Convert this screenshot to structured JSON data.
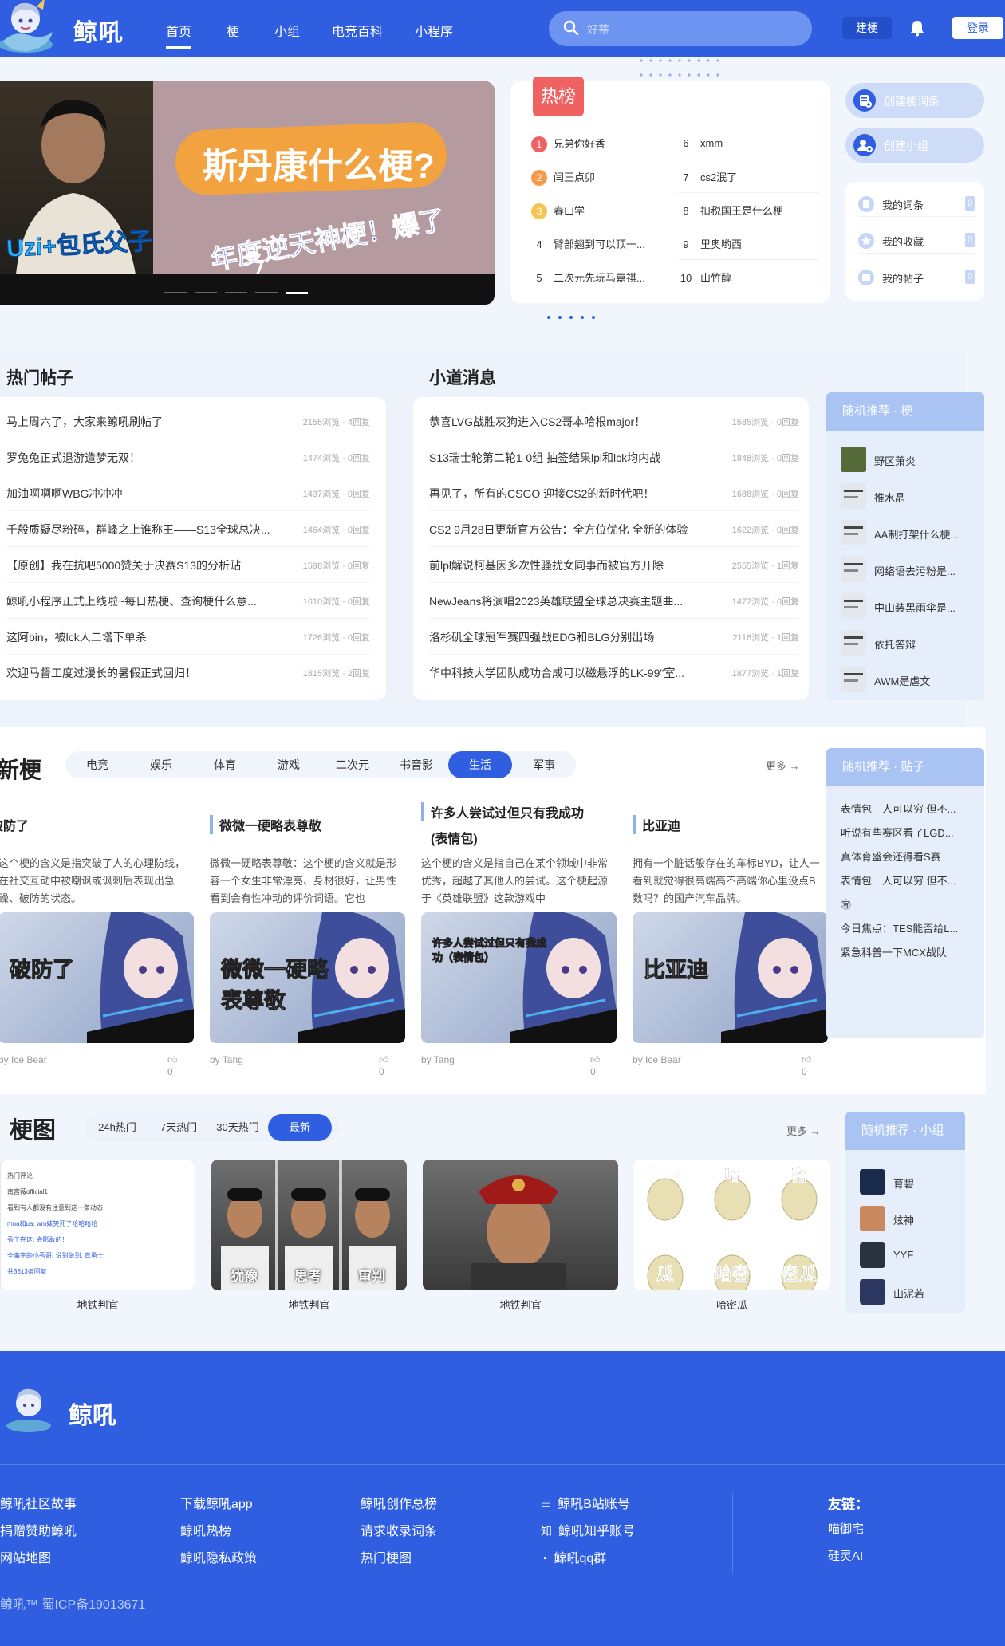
{
  "header": {
    "brand": "鲸吼",
    "nav": [
      "首页",
      "梗",
      "小组",
      "电竞百科",
      "小程序"
    ],
    "search_placeholder": "好蒂",
    "build_btn": "建梗",
    "login_btn": "登录"
  },
  "banner": {
    "left_caption": "Uzi+包氏父子",
    "question": "斯丹康什么梗?",
    "sub": "年度逆天神梗！爆了",
    "dots": 5,
    "active_dot": 4
  },
  "hot_rank": {
    "label": "热榜",
    "items": [
      {
        "n": "1",
        "t": "兄弟你好香"
      },
      {
        "n": "2",
        "t": "闫王点卯"
      },
      {
        "n": "3",
        "t": "春山学"
      },
      {
        "n": "4",
        "t": "臂部翘到可以顶一..."
      },
      {
        "n": "5",
        "t": "二次元先玩马嘉祺..."
      },
      {
        "n": "6",
        "t": "xmm"
      },
      {
        "n": "7",
        "t": "cs2泯了"
      },
      {
        "n": "8",
        "t": "扣税国王是什么梗"
      },
      {
        "n": "9",
        "t": "里奥哟西"
      },
      {
        "n": "10",
        "t": "山竹醇"
      }
    ]
  },
  "side_actions": {
    "create_term": "创建梗词条",
    "create_group": "创建小组",
    "mine": [
      {
        "label": "我的词条",
        "count": "0"
      },
      {
        "label": "我的收藏",
        "count": "0"
      },
      {
        "label": "我的帖子",
        "count": "0"
      }
    ]
  },
  "hot_posts": {
    "title": "热门帖子",
    "items": [
      {
        "t": "马上周六了，大家来鲸吼刷帖了",
        "m": "2155浏览 · 4回复"
      },
      {
        "t": "罗兔兔正式退游造梦无双！",
        "m": "1474浏览 · 0回复"
      },
      {
        "t": "加油啊啊啊WBG冲冲冲",
        "m": "1437浏览 · 0回复"
      },
      {
        "t": "千般质疑尽粉碎，群峰之上谁称王——S13全球总决...",
        "m": "1464浏览 · 0回复"
      },
      {
        "t": "【原创】我在抗吧5000赞关于决赛S13的分析贴",
        "m": "1598浏览 · 0回复"
      },
      {
        "t": "鲸吼小程序正式上线啦~每日热梗、查询梗什么意...",
        "m": "1610浏览 · 0回复"
      },
      {
        "t": "这阿bin，被lck人二塔下单杀",
        "m": "1726浏览 · 0回复"
      },
      {
        "t": "欢迎马督工度过漫长的暑假正式回归！",
        "m": "1815浏览 · 2回复"
      }
    ]
  },
  "news": {
    "title": "小道消息",
    "items": [
      {
        "t": "恭喜LVG战胜灰狗进入CS2哥本哈根major！",
        "m": "1585浏览 · 0回复"
      },
      {
        "t": "S13瑞士轮第二轮1-0组 抽签结果lpl和lck均内战",
        "m": "1848浏览 · 0回复"
      },
      {
        "t": "再见了，所有的CSGO 迎接CS2的新时代吧！",
        "m": "1688浏览 · 0回复"
      },
      {
        "t": "CS2 9月28日更新官方公告：全方位优化 全新的体验",
        "m": "1622浏览 · 0回复"
      },
      {
        "t": "前lpl解说柯基因多次性骚扰女同事而被官方开除",
        "m": "2555浏览 · 1回复"
      },
      {
        "t": "NewJeans将演唱2023英雄联盟全球总决赛主题曲...",
        "m": "1477浏览 · 0回复"
      },
      {
        "t": "洛杉矶全球冠军赛四强战EDG和BLG分别出场",
        "m": "2116浏览 · 1回复"
      },
      {
        "t": "华中科技大学团队成功合成可以磁悬浮的LK-99\"室...",
        "m": "1877浏览 · 1回复"
      }
    ]
  },
  "rand_memes": {
    "title": "随机推荐 · 梗",
    "items": [
      "野区萧炎",
      "推水晶",
      "AA制打架什么梗...",
      "网络语去污粉是...",
      "中山装黑雨伞是...",
      "依托答辩",
      "AWM是虐文"
    ]
  },
  "new_memes": {
    "title": "新梗",
    "tabs": [
      "电竞",
      "娱乐",
      "体育",
      "游戏",
      "二次元",
      "书音影",
      "生活",
      "军事"
    ],
    "active_tab": 6,
    "more": "更多",
    "cards": [
      {
        "title": "破防了",
        "desc": "这个梗的含义是指突破了人的心理防线，在社交互动中被嘲讽或讽刺后表现出急躁、破防的状态。",
        "img": "破防了",
        "by": "by Ice Bear",
        "likes": "0"
      },
      {
        "title": "微微一硬略表尊敬",
        "desc": "微微一硬略表尊敬：这个梗的含义就是形容一个女生非常漂亮、身材很好，让男性看到会有性冲动的评价词语。它也",
        "img": "微微一硬略表尊敬",
        "by": "by Tang",
        "likes": "0"
      },
      {
        "title": "许多人尝试过但只有我成功",
        "title2": "(表情包)",
        "desc": "这个梗的含义是指自己在某个领域中非常优秀，超越了其他人的尝试。这个梗起源于《英雄联盟》这款游戏中",
        "img": "许多人尝试过但只有我成功（表情包）",
        "by": "by Tang",
        "likes": "0"
      },
      {
        "title": "比亚迪",
        "desc": "拥有一个脏话般存在的车标BYD，让人一看到就觉得很高端高不高端你心里没点B数吗？的国产汽车品牌。",
        "img": "比亚迪",
        "by": "by Ice Bear",
        "likes": "0"
      }
    ]
  },
  "rand_posts": {
    "title": "随机推荐 · 贴子",
    "items": [
      "表情包｜人可以穷 但不...",
      "听说有些赛区看了LGD...",
      "真体育盛会还得看S赛",
      "表情包｜人可以穷 但不...",
      "㊢",
      "今日焦点：TES能否给L...",
      "紧急科普一下MCX战队"
    ]
  },
  "meme_pics": {
    "title": "梗图",
    "tabs": [
      "24h热门",
      "7天热门",
      "30天热门",
      "最新"
    ],
    "active_tab": 3,
    "more": "更多",
    "items": [
      {
        "caption": "地铁判官",
        "thumb_lines": [
          "热门评论",
          "南宫薇official1",
          "看到有人都没有注意到这一条动态",
          "mua和ua: wm妹笑死了哈哈哈哈",
          "秀了在这: 会影敢的！",
          "全事字的小秀哥: 说到做到, 真勇士",
          "共3613条回复"
        ]
      },
      {
        "caption": "地铁判官",
        "labels": [
          "犹豫",
          "思考",
          "审判"
        ]
      },
      {
        "caption": "地铁判官"
      },
      {
        "caption": "哈密瓜",
        "grid": [
          "哈密瓜",
          "哈",
          "密",
          "瓜",
          "哈密",
          "密瓜"
        ]
      }
    ]
  },
  "rand_groups": {
    "title": "随机推荐 · 小组",
    "items": [
      "育碧",
      "炫神",
      "YYF",
      "山泥若"
    ]
  },
  "footer": {
    "brand": "鲸吼",
    "cols": [
      [
        "鲸吼社区故事",
        "捐赠赞助鲸吼",
        "网站地图"
      ],
      [
        "下载鲸吼app",
        "鲸吼热榜",
        "鲸吼隐私政策"
      ],
      [
        "鲸吼创作总榜",
        "请求收录词条",
        "热门梗图"
      ],
      [
        "鲸吼B站账号",
        "鲸吼知乎账号",
        "鲸吼qq群"
      ]
    ],
    "friends_label": "友链：",
    "friends": [
      "喵御宅",
      "硅灵AI"
    ],
    "icp": "鲸吼™ 蜀ICP备19013671"
  },
  "colors": {
    "primary": "#2f5fe0",
    "light": "#a9c3f2",
    "hot": "#f06262"
  }
}
